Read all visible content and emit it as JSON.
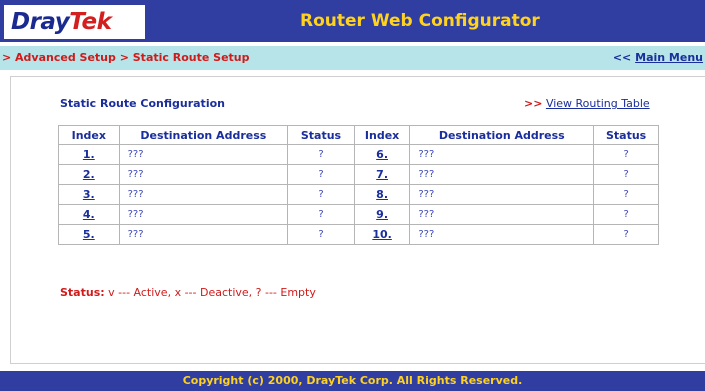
{
  "header": {
    "logo_part1": "Dray",
    "logo_part2": "Tek",
    "title": "Router Web Configurator"
  },
  "breadcrumb": {
    "text": "> Advanced Setup > Static Route Setup",
    "main_menu_arrows": "<<",
    "main_menu_label": "Main Menu"
  },
  "content": {
    "section_title": "Static Route Configuration",
    "view_routing_arrows": ">>",
    "view_routing_label": "View Routing Table"
  },
  "table": {
    "headers": [
      "Index",
      "Destination Address",
      "Status",
      "Index",
      "Destination Address",
      "Status"
    ],
    "rows": [
      {
        "idx_left": "1.",
        "addr_left": "???",
        "status_left": "?",
        "idx_right": "6.",
        "addr_right": "???",
        "status_right": "?"
      },
      {
        "idx_left": "2.",
        "addr_left": "???",
        "status_left": "?",
        "idx_right": "7.",
        "addr_right": "???",
        "status_right": "?"
      },
      {
        "idx_left": "3.",
        "addr_left": "???",
        "status_left": "?",
        "idx_right": "8.",
        "addr_right": "???",
        "status_right": "?"
      },
      {
        "idx_left": "4.",
        "addr_left": "???",
        "status_left": "?",
        "idx_right": "9.",
        "addr_right": "???",
        "status_right": "?"
      },
      {
        "idx_left": "5.",
        "addr_left": "???",
        "status_left": "?",
        "idx_right": "10.",
        "addr_right": "???",
        "status_right": "?"
      }
    ]
  },
  "legend": {
    "label": "Status:",
    "text": " v --- Active, x --- Deactive, ? --- Empty"
  },
  "footer": {
    "copyright": "Copyright (c) 2000, DrayTek Corp. All Rights Reserved."
  },
  "colors": {
    "header_bg": "#2f3ea0",
    "title_yellow": "#ffd21f",
    "breadcrumb_bg": "#b6e4e8",
    "accent_red": "#d11a1a",
    "link_blue": "#1a2e9c"
  }
}
